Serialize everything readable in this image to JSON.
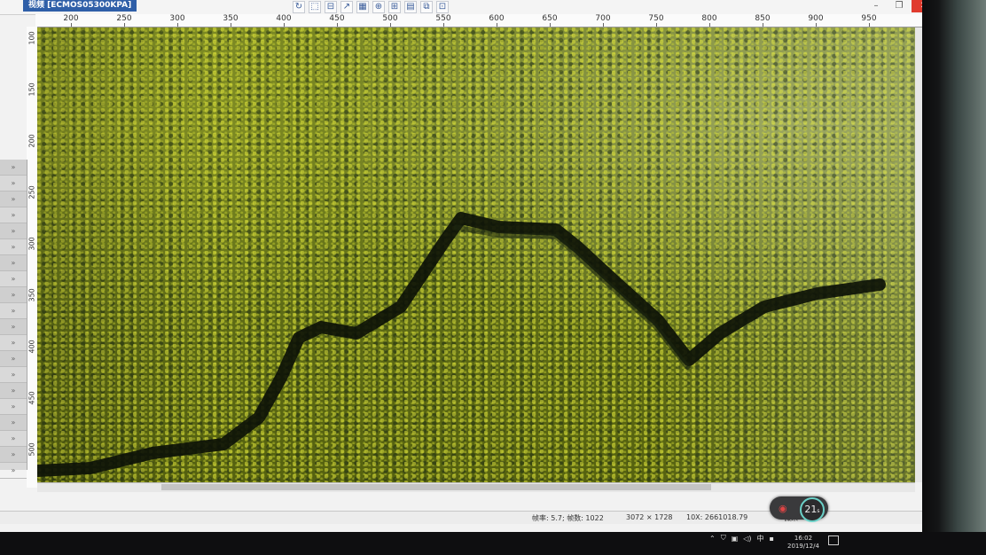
{
  "window": {
    "doc_tab": "视频 [ECMOS05300KPA]",
    "close_glyph": "✕",
    "max_glyph": "❐",
    "min_glyph": "–"
  },
  "toolbar": {
    "icons": [
      "rotate-icon",
      "select-icon",
      "align-icon",
      "arrow-icon",
      "group-icon",
      "measure-icon",
      "distribute-icon",
      "layer-icon",
      "copy-icon",
      "crop-icon"
    ]
  },
  "ruler_top": {
    "ticks": [
      "200",
      "250",
      "300",
      "350",
      "400",
      "450",
      "500",
      "550",
      "600",
      "650",
      "700",
      "750",
      "800",
      "850",
      "900",
      "950"
    ]
  },
  "ruler_left": {
    "ticks": [
      "100",
      "150",
      "200",
      "250",
      "300",
      "350",
      "400",
      "450",
      "500"
    ]
  },
  "side_panel": {
    "rows": [
      "»",
      "»",
      "»",
      "»",
      "»",
      "»",
      "»",
      "»",
      "»",
      "»",
      "»",
      "»",
      "»",
      "»",
      "»",
      "»",
      "»",
      "»",
      "»",
      "»"
    ]
  },
  "statusbar": {
    "frame_rate": "帧率: 5.7; 帧数: 1022",
    "resolution": "3072 × 1728",
    "magnification": "10X: 2661018.79",
    "unit": "微米"
  },
  "overlay_widget": {
    "value": "21",
    "unit_suffix": "s"
  },
  "taskbar": {
    "ime": "中",
    "time": "16:02",
    "date": "2019/12/4"
  }
}
